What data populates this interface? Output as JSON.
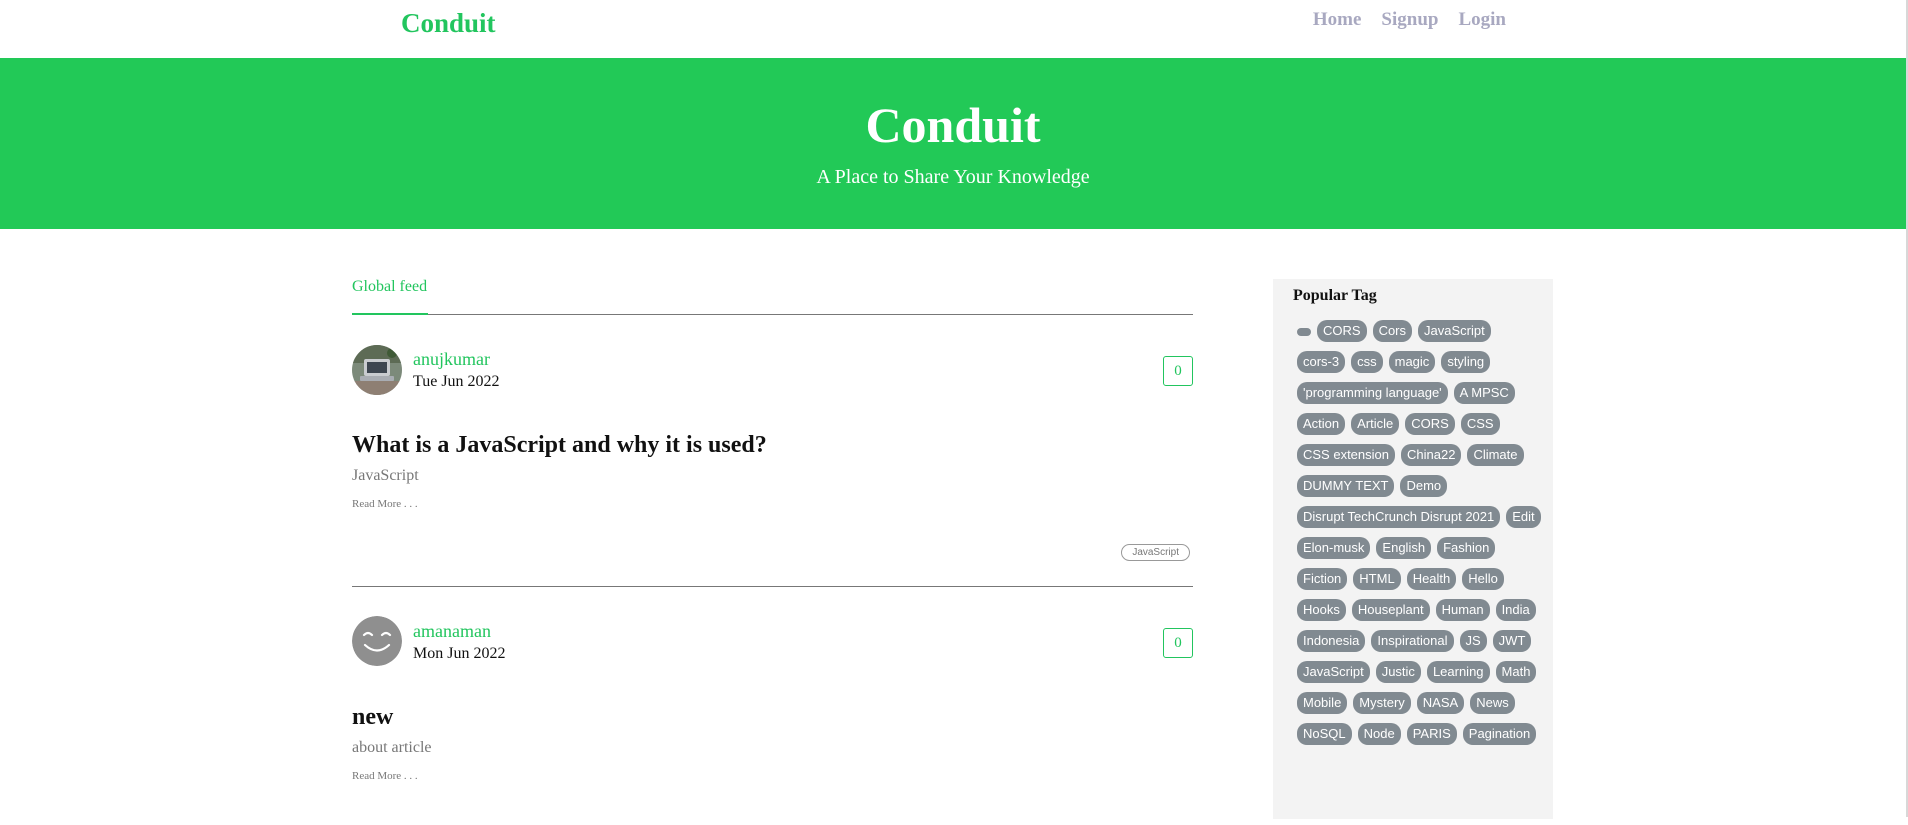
{
  "navbar": {
    "brand": "Conduit",
    "links": [
      {
        "label": "Home"
      },
      {
        "label": "Signup"
      },
      {
        "label": "Login"
      }
    ]
  },
  "banner": {
    "title": "Conduit",
    "subtitle": "A Place to Share Your Knowledge"
  },
  "feed": {
    "tab_label": "Global feed",
    "read_more_label": "Read More . . .",
    "articles": [
      {
        "author": "anujkumar",
        "date": "Tue Jun 2022",
        "likes": "0",
        "title": "What is a JavaScript and why it is used?",
        "description": "JavaScript",
        "tags": [
          "JavaScript"
        ],
        "avatar": "photo-avatar"
      },
      {
        "author": "amanaman",
        "date": "Mon Jun 2022",
        "likes": "0",
        "title": "new",
        "description": "about article",
        "tags": [],
        "avatar": "smiley-avatar"
      }
    ]
  },
  "sidebar": {
    "title": "Popular Tag",
    "tags": [
      "",
      "CORS",
      "Cors",
      "JavaScript",
      "cors-3",
      "css",
      "magic",
      "styling",
      "'programming language'",
      "A MPSC",
      "Action",
      "Article",
      "CORS",
      "CSS",
      "CSS extension",
      "China22",
      "Climate",
      "DUMMY TEXT",
      "Demo",
      "Disrupt TechCrunch Disrupt 2021",
      "Edit",
      "Elon-musk",
      "English",
      "Fashion",
      "Fiction",
      "HTML",
      "Health",
      "Hello",
      "Hooks",
      "Houseplant",
      "Human",
      "India",
      "Indonesia",
      "Inspirational",
      "JS",
      "JWT",
      "JavaScript",
      "Justic",
      "Learning",
      "Math",
      "Mobile",
      "Mystery",
      "NASA",
      "News",
      "NoSQL",
      "Node",
      "PARIS",
      "Pagination"
    ]
  },
  "colors": {
    "brand_green": "#22c55e",
    "banner_green": "#22c957",
    "tag_gray": "#818a91"
  }
}
